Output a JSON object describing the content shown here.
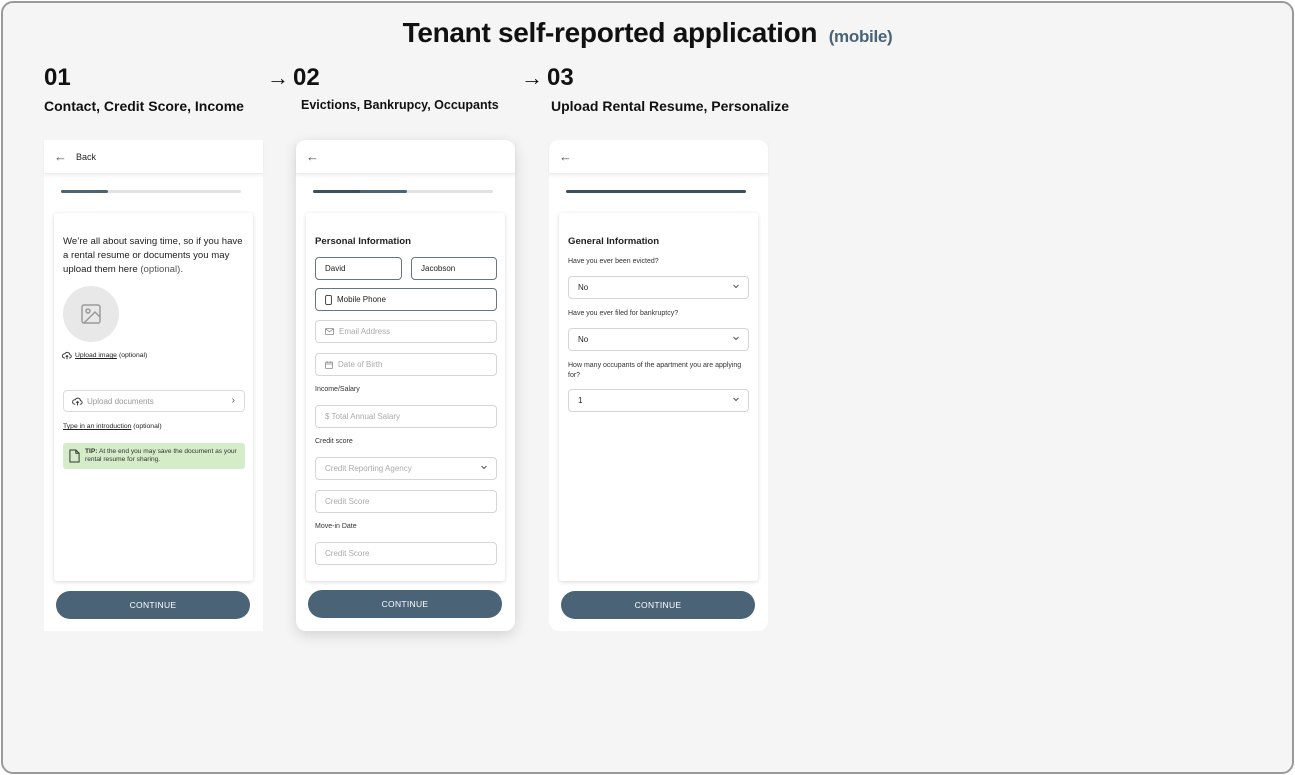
{
  "title": "Tenant self-reported application",
  "title_suffix": "(mobile)",
  "steps": [
    {
      "number": "01",
      "label": "Contact, Credit Score, Income"
    },
    {
      "number": "02",
      "label": "Evictions, Bankrupcy, Occupants",
      "arrow": "→"
    },
    {
      "number": "03",
      "label": "Upload Rental Resume, Personalize",
      "arrow": "→"
    }
  ],
  "screen1": {
    "back_label": "Back",
    "progress": 0.26,
    "intro_text": "We’re all about saving time, so if you have a rental resume or documents you may upload them here",
    "intro_optional": "(optional).",
    "upload_image_link": "Upload image",
    "upload_image_optional": "(optional)",
    "upload_documents_label": "Upload documents",
    "intro_link": "Type in an introduction",
    "intro_link_optional": "(optional)",
    "tip_bold": "TIP:",
    "tip_text": "At the end you may save the document as your rental resume for sharing.",
    "continue_label": "CONTINUE"
  },
  "screen2": {
    "progress": 0.52,
    "section_title": "Personal Information",
    "first_name": "David",
    "last_name": "Jacobson",
    "mobile_phone": "Mobile Phone",
    "email_placeholder": "Email Address",
    "dob_placeholder": "Date of Birth",
    "income_label": "Income/Salary",
    "salary_placeholder": "$ Total Annual Salary",
    "credit_label": "Credit score",
    "agency_placeholder": "Credit Reporting Agency",
    "credit_score_placeholder": "Credit Score",
    "movein_label": "Move-in Date",
    "movein_placeholder": "Credit Score",
    "continue_label": "CONTINUE"
  },
  "screen3": {
    "progress": 1.0,
    "section_title": "General Information",
    "q_evicted": "Have you ever been evicted?",
    "a_evicted": "No",
    "q_bankruptcy": "Have you ever filed for bankruptcy?",
    "a_bankruptcy": "No",
    "q_occupants": "How many occupants of the apartment you are applying for?",
    "a_occupants": "1",
    "continue_label": "CONTINUE"
  }
}
